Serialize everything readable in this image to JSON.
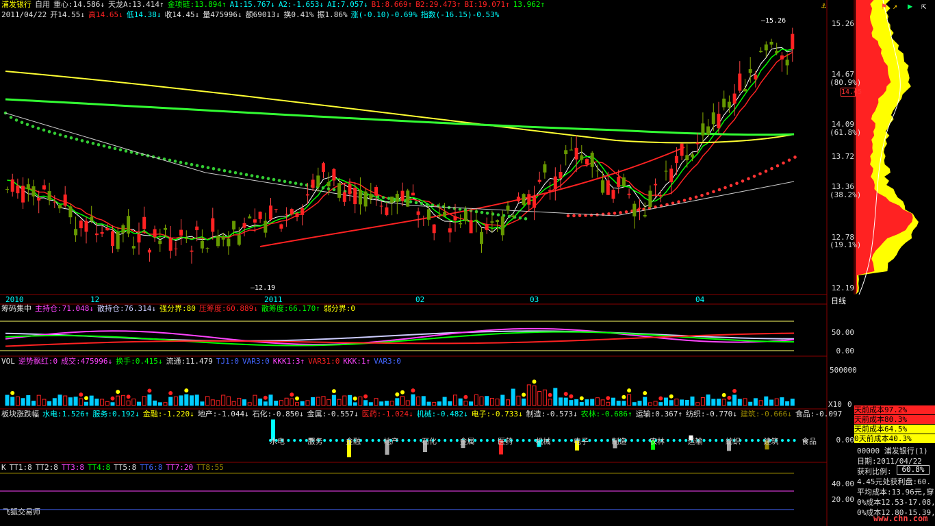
{
  "header": {
    "stock_name": "浦发银行",
    "tab_custom": "自用",
    "indicators_row1": [
      {
        "text": "重心:14.586↓",
        "color": "#e0e0e0"
      },
      {
        "text": "天龙A:13.414↑",
        "color": "#e0e0e0"
      },
      {
        "text": "金项链:13.894↑",
        "color": "#00ff00"
      },
      {
        "text": "A1:15.767↓",
        "color": "#00ffff"
      },
      {
        "text": "A2:-1.653↓",
        "color": "#00ffff"
      },
      {
        "text": "AI:7.057↓",
        "color": "#00ffff"
      },
      {
        "text": "B1:8.669↑",
        "color": "#ff2222"
      },
      {
        "text": "B2:29.473↑",
        "color": "#ff2222"
      },
      {
        "text": "BI:19.071↑",
        "color": "#ff2222"
      },
      {
        "text": "13.962↑",
        "color": "#00ff00"
      }
    ],
    "date": "2011/04/22",
    "indicators_row2": [
      {
        "text": "开14.55↓",
        "color": "#e0e0e0"
      },
      {
        "text": "高14.65↓",
        "color": "#ff2222"
      },
      {
        "text": "低14.38↓",
        "color": "#00ffff"
      },
      {
        "text": "收14.45↓",
        "color": "#e0e0e0"
      },
      {
        "text": "量475996↓",
        "color": "#e0e0e0"
      },
      {
        "text": "额69013↓",
        "color": "#e0e0e0"
      },
      {
        "text": "换0.41%",
        "color": "#e0e0e0"
      },
      {
        "text": "振1.86%",
        "color": "#e0e0e0"
      },
      {
        "text": "涨(-0.10)-0.69%",
        "color": "#00ffff"
      },
      {
        "text": "指数(-16.15)-0.53%",
        "color": "#00ffff"
      }
    ]
  },
  "price_axis": {
    "labels": [
      {
        "text": "15.26",
        "color": "#ddd"
      },
      {
        "text": "14.67",
        "color": "#ddd"
      },
      {
        "text": "(80.9%)",
        "color": "#ddd"
      },
      {
        "text": "14.45",
        "color": "#ff3333"
      },
      {
        "text": "14.09",
        "color": "#ddd"
      },
      {
        "text": "(61.8%)",
        "color": "#ddd"
      },
      {
        "text": "13.72",
        "color": "#ddd"
      },
      {
        "text": "13.36",
        "color": "#ddd"
      },
      {
        "text": "(38.2%)",
        "color": "#ddd"
      },
      {
        "text": "12.78",
        "color": "#ddd"
      },
      {
        "text": "(19.1%)",
        "color": "#ddd"
      },
      {
        "text": "12.19",
        "color": "#ddd"
      }
    ],
    "high_marker": "15.26",
    "low_marker": "12.19"
  },
  "date_axis": {
    "labels": [
      "2010",
      "12",
      "2011",
      "02",
      "03",
      "04"
    ],
    "period": "日线"
  },
  "chip_panel": {
    "title": "筹码集中",
    "items": [
      {
        "text": "主持仓:71.048↓",
        "color": "#ff44ff"
      },
      {
        "text": "散持仓:76.314↓",
        "color": "#ccccff"
      },
      {
        "text": "强分界:80",
        "color": "#ffff00"
      },
      {
        "text": "压筹度:60.889↓",
        "color": "#ff2222"
      },
      {
        "text": "散筹度:66.170↑",
        "color": "#00ff00"
      },
      {
        "text": "弱分界:0",
        "color": "#ffff00"
      }
    ],
    "axis": [
      "50.00",
      "0.00"
    ]
  },
  "vol_panel": {
    "title": "VOL",
    "items": [
      {
        "text": "逆势飘红:0",
        "color": "#ff44ff"
      },
      {
        "text": "成交:475996↓",
        "color": "#ff44ff"
      },
      {
        "text": "换手:0.415↓",
        "color": "#00ff00"
      },
      {
        "text": "流通:11.479",
        "color": "#e0e0e0"
      },
      {
        "text": "TJ1:0",
        "color": "#4466ff"
      },
      {
        "text": "VAR3:0",
        "color": "#4466ff"
      },
      {
        "text": "KKK1:3↑",
        "color": "#ff44ff"
      },
      {
        "text": "VAR31:0",
        "color": "#ff2222"
      },
      {
        "text": "KKK:1↑",
        "color": "#ff44ff"
      },
      {
        "text": "VAR3:0",
        "color": "#4466ff"
      }
    ],
    "axis": [
      "500000",
      "X10",
      "0"
    ]
  },
  "sector_panel": {
    "title": "板块涨跌幅",
    "items": [
      {
        "text": "水电:1.526↑",
        "color": "#00ffff"
      },
      {
        "text": "服务:0.192↓",
        "color": "#00ffff"
      },
      {
        "text": "金融:-1.220↓",
        "color": "#ffff00"
      },
      {
        "text": "地产:-1.044↓",
        "color": "#e0e0e0"
      },
      {
        "text": "石化:-0.850↓",
        "color": "#e0e0e0"
      },
      {
        "text": "金属:-0.557↓",
        "color": "#e0e0e0"
      },
      {
        "text": "医药:-1.024↓",
        "color": "#ff2222"
      },
      {
        "text": "机械:-0.482↓",
        "color": "#00ffff"
      },
      {
        "text": "电子:-0.733↓",
        "color": "#ffff00"
      },
      {
        "text": "制造:-0.573↓",
        "color": "#e0e0e0"
      },
      {
        "text": "农林:-0.686↑",
        "color": "#00ff00"
      },
      {
        "text": "运输:0.367↑",
        "color": "#e0e0e0"
      },
      {
        "text": "纺织:-0.770↓",
        "color": "#e0e0e0"
      },
      {
        "text": "建筑:-0.666↓",
        "color": "#998800"
      },
      {
        "text": "食品:-0.097",
        "color": "#e0e0e0"
      }
    ],
    "labels": [
      "水电",
      "服务",
      "金融",
      "地产",
      "石化",
      "金属",
      "医药",
      "机械",
      "电子",
      "制造",
      "农林",
      "运输",
      "纺织",
      "建筑",
      "食品"
    ],
    "values": [
      1.526,
      0.192,
      -1.22,
      -1.044,
      -0.85,
      -0.557,
      -1.024,
      -0.482,
      -0.733,
      -0.573,
      -0.686,
      0.367,
      -0.77,
      -0.666,
      -0.097
    ],
    "colors": [
      "#00ffff",
      "#aaaaaa",
      "#ffff00",
      "#aaaaaa",
      "#aaaaaa",
      "#aaaaaa",
      "#ff2222",
      "#00ffff",
      "#ffff00",
      "#aaaaaa",
      "#00ff00",
      "#ffffff",
      "#aaaaaa",
      "#998800",
      "#aaaaaa"
    ],
    "axis": "0.00"
  },
  "kk_panel": {
    "title": "K",
    "items": [
      {
        "text": "TT1:8",
        "color": "#e0e0e0"
      },
      {
        "text": "TT2:8",
        "color": "#e0e0e0"
      },
      {
        "text": "TT3:8",
        "color": "#ff44ff"
      },
      {
        "text": "TT4:8",
        "color": "#00ff00"
      },
      {
        "text": "TT5:8",
        "color": "#e0e0e0"
      },
      {
        "text": "TT6:8",
        "color": "#4466ff"
      },
      {
        "text": "TT7:20",
        "color": "#ff44ff"
      },
      {
        "text": "TT8:55",
        "color": "#998800"
      }
    ],
    "axis": [
      "40.00",
      "20.00"
    ],
    "footer": "飞狐交易师"
  },
  "right_panel": {
    "cost_boxes": [
      {
        "text": "天前成本97.2%",
        "bg": "#ff2222"
      },
      {
        "text": "天前成本80.3%",
        "bg": "#ff2222"
      },
      {
        "text": "天前成本64.5%",
        "bg": "#ffff00"
      },
      {
        "text": "0天前成本40.3%",
        "bg": "#ffff00"
      }
    ],
    "info_lines": [
      "00000 浦发银行(1)",
      "日期:2011/04/22",
      "获利比例:",
      "4.45元处获利盘:60.",
      "平均成本:13.96元,穿",
      "0%成本12.53-17.08,",
      "0%成本12.80-15.39,"
    ],
    "profit_ratio": "60.8%",
    "watermark": "www.chn.com"
  }
}
